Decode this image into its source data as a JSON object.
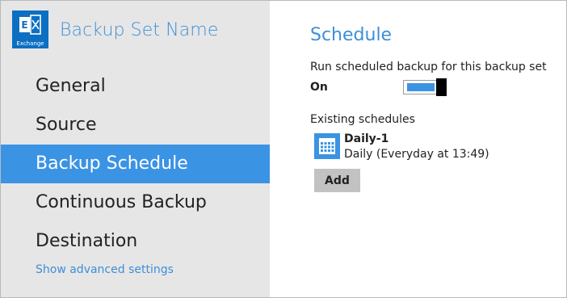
{
  "sidebar": {
    "app_icon": {
      "name": "exchange-icon",
      "caption": "Exchange",
      "color": "#0d6fc2"
    },
    "title": "Backup Set Name",
    "items": [
      {
        "label": "General",
        "active": false
      },
      {
        "label": "Source",
        "active": false
      },
      {
        "label": "Backup Schedule",
        "active": true
      },
      {
        "label": "Continuous Backup",
        "active": false
      },
      {
        "label": "Destination",
        "active": false
      }
    ],
    "advanced_link": "Show advanced settings"
  },
  "main": {
    "title": "Schedule",
    "run_label": "Run scheduled backup for this backup set",
    "toggle": {
      "state_label": "On",
      "on": true
    },
    "existing_label": "Existing schedules",
    "schedules": [
      {
        "icon": "calendar-icon",
        "name": "Daily-1",
        "description": "Daily (Everyday at 13:49)"
      }
    ],
    "add_label": "Add"
  },
  "colors": {
    "accent": "#3b93e4",
    "sidebar_bg": "#e6e6e6",
    "heading_text": "#3d8fd8",
    "button_bg": "#c2c2c2"
  }
}
